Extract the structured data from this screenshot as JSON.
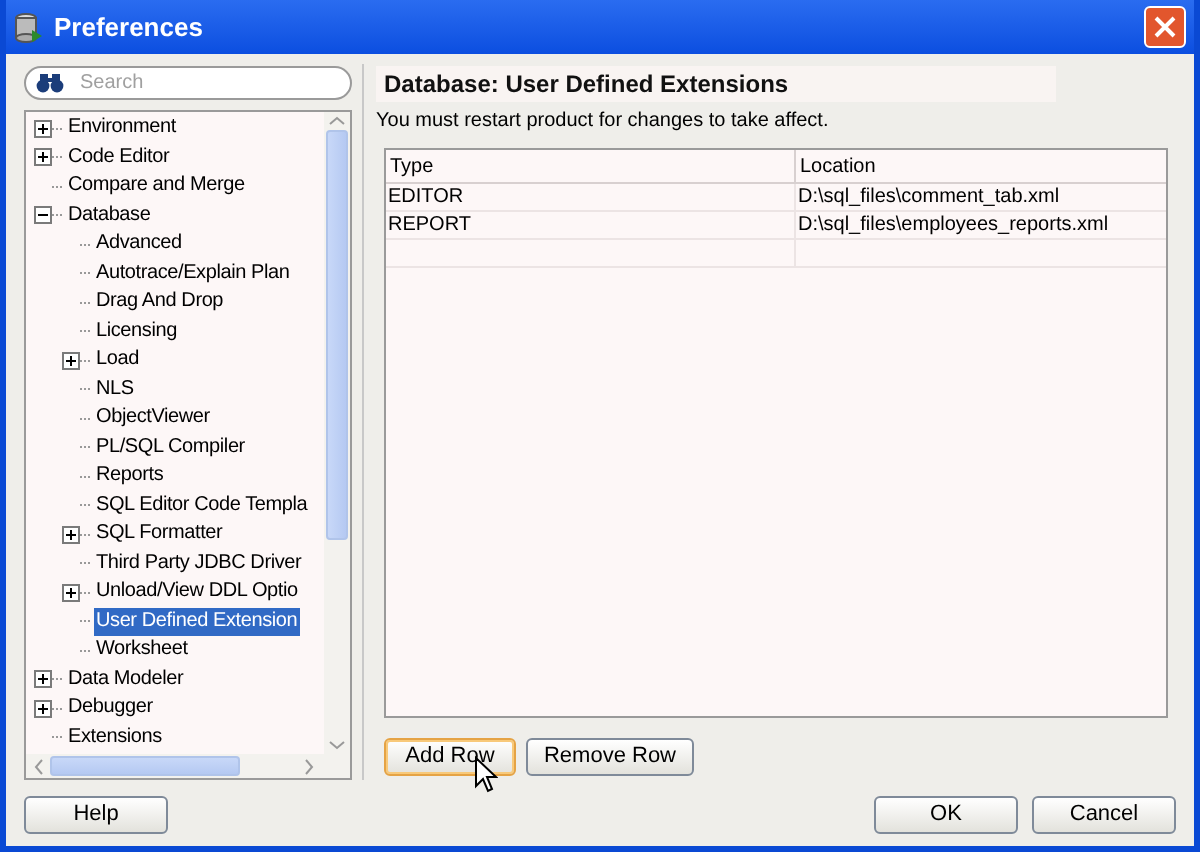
{
  "window": {
    "title": "Preferences"
  },
  "search": {
    "placeholder": "Search"
  },
  "tree": [
    {
      "label": "Environment",
      "kind": "group",
      "expanded": false,
      "selected": false
    },
    {
      "label": "Code Editor",
      "kind": "group",
      "expanded": false,
      "selected": false
    },
    {
      "label": "Compare and Merge",
      "kind": "leaf",
      "selected": false
    },
    {
      "label": "Database",
      "kind": "group",
      "expanded": true,
      "selected": false,
      "children": [
        {
          "label": "Advanced",
          "kind": "leaf",
          "selected": false
        },
        {
          "label": "Autotrace/Explain Plan",
          "kind": "leaf",
          "selected": false
        },
        {
          "label": "Drag And Drop",
          "kind": "leaf",
          "selected": false
        },
        {
          "label": "Licensing",
          "kind": "leaf",
          "selected": false
        },
        {
          "label": "Load",
          "kind": "group",
          "expanded": false,
          "selected": false
        },
        {
          "label": "NLS",
          "kind": "leaf",
          "selected": false
        },
        {
          "label": "ObjectViewer",
          "kind": "leaf",
          "selected": false
        },
        {
          "label": "PL/SQL Compiler",
          "kind": "leaf",
          "selected": false
        },
        {
          "label": "Reports",
          "kind": "leaf",
          "selected": false
        },
        {
          "label": "SQL Editor Code Templa",
          "kind": "leaf",
          "selected": false
        },
        {
          "label": "SQL Formatter",
          "kind": "group",
          "expanded": false,
          "selected": false
        },
        {
          "label": "Third Party JDBC Driver",
          "kind": "leaf",
          "selected": false
        },
        {
          "label": "Unload/View DDL Optio",
          "kind": "group",
          "expanded": false,
          "selected": false
        },
        {
          "label": "User Defined Extension",
          "kind": "leaf",
          "selected": true
        },
        {
          "label": "Worksheet",
          "kind": "leaf",
          "selected": false
        }
      ]
    },
    {
      "label": "Data Modeler",
      "kind": "group",
      "expanded": false,
      "selected": false
    },
    {
      "label": "Debugger",
      "kind": "group",
      "expanded": false,
      "selected": false
    },
    {
      "label": "Extensions",
      "kind": "leaf",
      "selected": false
    }
  ],
  "panel": {
    "title": "Database: User Defined Extensions",
    "message": "You must restart product for changes to take affect."
  },
  "table": {
    "columns": [
      "Type",
      "Location"
    ],
    "rows": [
      [
        "EDITOR",
        "D:\\sql_files\\comment_tab.xml"
      ],
      [
        "REPORT",
        "D:\\sql_files\\employees_reports.xml"
      ]
    ]
  },
  "table_buttons": [
    {
      "label": "Add Row",
      "focused": true
    },
    {
      "label": "Remove Row",
      "focused": false
    }
  ],
  "footer": {
    "help": "Help",
    "buttons": [
      "OK",
      "Cancel"
    ]
  }
}
